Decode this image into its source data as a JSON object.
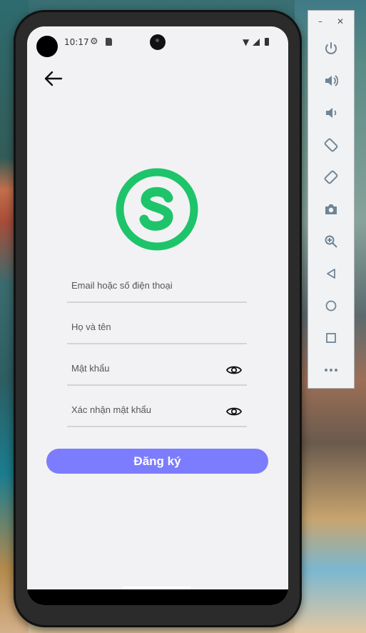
{
  "status_bar": {
    "time": "10:17"
  },
  "signup_form": {
    "fields": [
      {
        "placeholder": "Email hoặc số điện thoại"
      },
      {
        "placeholder": "Họ và tên"
      },
      {
        "placeholder": "Mật khẩu"
      },
      {
        "placeholder": "Xác nhận mật khẩu"
      }
    ],
    "submit_label": "Đăng ký"
  },
  "colors": {
    "brand_green": "#1ec46a",
    "button_purple": "#7c7cff"
  },
  "emulator_toolbar": {
    "icons": [
      "power-icon",
      "volume-up-icon",
      "volume-down-icon",
      "rotate-left-icon",
      "rotate-right-icon",
      "camera-icon",
      "zoom-icon",
      "back-icon",
      "home-icon",
      "overview-icon",
      "more-icon"
    ]
  }
}
